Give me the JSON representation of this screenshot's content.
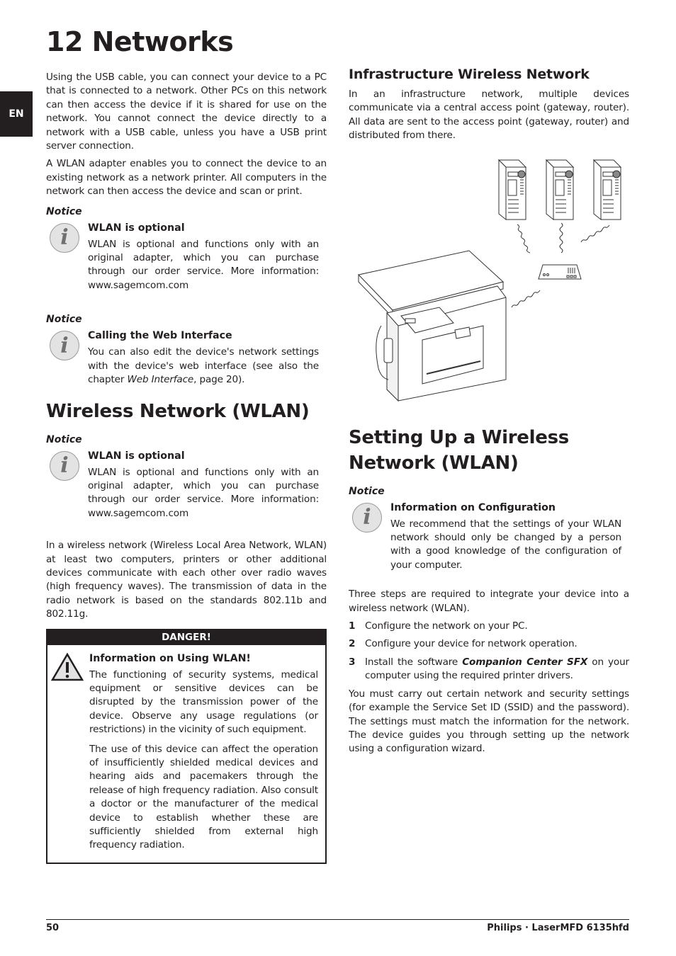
{
  "language_tab": "EN",
  "chapter": {
    "number": "12",
    "title": "Networks"
  },
  "left": {
    "intro": [
      "Using the USB cable, you can connect your device to a PC that is connected to a network. Other PCs on this network can then access the device if it is shared for use on the network. You cannot connect the device directly to a network with a USB cable, unless you have a USB print server connection.",
      "A WLAN adapter enables you to connect the device to an existing network as a network printer. All computers in the network can then access the device and scan or print."
    ],
    "notice1": {
      "label": "Notice",
      "title": "WLAN is optional",
      "text": "WLAN is optional and functions only with an original adapter, which you can purchase through our order service. More information: www.sagemcom.com"
    },
    "notice2": {
      "label": "Notice",
      "title": "Calling the Web Interface",
      "text_before": "You can also edit the device's network settings with the device's web interface (see also the chapter ",
      "text_italic": "Web Interface",
      "text_after": ", page  20)."
    },
    "section_wlan": {
      "heading": "Wireless Network (WLAN)",
      "notice": {
        "label": "Notice",
        "title": "WLAN is optional",
        "text": "WLAN is optional and functions only with an original adapter, which you can purchase through our order service. More information: www.sagemcom.com"
      },
      "paragraph": "In a wireless network (Wireless Local Area Network, WLAN) at least two computers, printers or other additional devices communicate with each other over radio waves (high frequency waves). The transmission of data in the radio network is based on the standards 802.11b and 802.11g."
    },
    "danger": {
      "header": "DANGER!",
      "title": "Information on Using WLAN!",
      "paragraphs": [
        "The functioning of security systems, medical equipment or sensitive devices can be disrupted by the transmission power of the device. Observe any usage regulations (or restrictions) in the vicinity of such equipment.",
        "The use of this device can affect the operation of insufficiently shielded medical devices and hearing aids and pacemakers through the release of high frequency radiation. Also consult a doctor or the manufacturer of the medical device to establish whether these are sufficiently shielded from external high frequency radiation."
      ]
    }
  },
  "right": {
    "infra": {
      "heading": "Infrastructure Wireless Network",
      "paragraph": "In an infrastructure network, multiple devices communicate via a central access point (gateway, router). All data are sent to the access point (gateway, router) and distributed from there."
    },
    "diagram": {
      "description": "Three PC towers connected wirelessly to a router, which connects wirelessly to the multifunction printer",
      "computers": 3
    },
    "setup": {
      "heading": "Setting Up a Wireless Network (WLAN)",
      "notice": {
        "label": "Notice",
        "title": "Information on Configuration",
        "text": "We recommend that the settings of your WLAN network should only be changed by a person with a good knowledge of the configuration of your computer."
      },
      "intro": "Three steps are required to integrate your device into a wireless network (WLAN).",
      "steps": [
        {
          "num": "1",
          "text": "Configure the network on your PC."
        },
        {
          "num": "2",
          "text": "Configure your device for network operation."
        },
        {
          "num": "3",
          "text_before": "Install the software ",
          "text_bold_italic": "Companion Center SFX",
          "text_after": " on your computer using the required printer drivers."
        }
      ],
      "closing": "You must carry out certain network and security settings (for example the Service Set ID (SSID) and the password). The settings must match the information for the network. The device guides you through setting up the network using a configuration wizard."
    }
  },
  "footer": {
    "page": "50",
    "product": "Philips · LaserMFD 6135hfd"
  }
}
